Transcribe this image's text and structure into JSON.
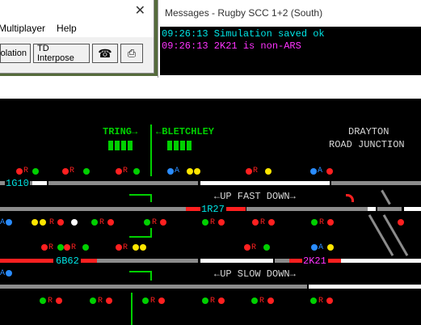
{
  "main_window": {
    "menu": [
      "Multiplayer",
      "Help"
    ],
    "toolbar": {
      "isolation_label": "Isolation",
      "td_interpose_label": "TD Interpose"
    }
  },
  "messages_window": {
    "title": "Messages - Rugby SCC 1+2 (South)",
    "lines": [
      {
        "text": "09:26:13 Simulation saved ok",
        "color": "#00e5e5"
      },
      {
        "text": "09:26:13 2K21 is non-ARS",
        "color": "#ff33ff"
      }
    ]
  },
  "diagram": {
    "direction_left": "TRING→",
    "direction_right": "←BLETCHLEY",
    "location_line1": "DRAYTON",
    "location_line2": "ROAD JUNCTION",
    "up_fast_down": "←UP FAST DOWN→",
    "up_slow_down": "←UP SLOW DOWN→",
    "berths": [
      "1G10",
      "1R27",
      "6B62",
      "2K21"
    ],
    "route_marker_R": "R",
    "route_marker_A": "A",
    "colors": {
      "green": "#00d000",
      "red": "#ff2020",
      "yellow": "#ffe600",
      "blue": "#2a8cff",
      "white": "#ffffff",
      "grey": "#8c8c8c",
      "cyan": "#00e5e5",
      "magenta": "#ff33ff"
    }
  }
}
